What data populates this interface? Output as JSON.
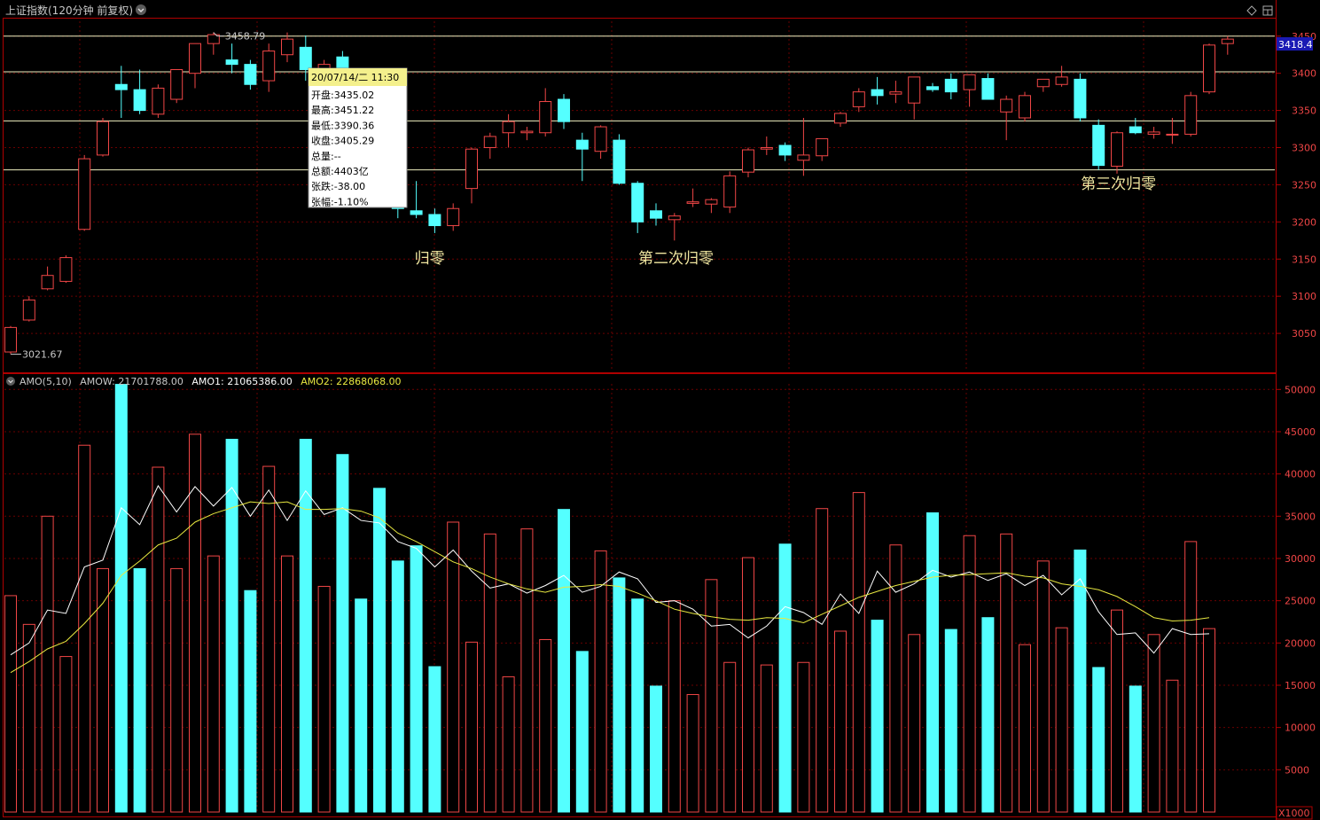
{
  "header": {
    "title": "上证指数(120分钟 前复权)",
    "icon_left": "chevron-down-icon",
    "icon_right_1": "diamond-icon",
    "icon_right_2": "layout-icon"
  },
  "price_panel": {
    "current_price_label": "3418.4",
    "high_label": "3458.79",
    "low_label": "3021.67",
    "y_ticks": [
      "3450",
      "3400",
      "3350",
      "3300",
      "3250",
      "3200",
      "3150",
      "3100",
      "3050"
    ],
    "horizontal_lines": [
      3450,
      3402,
      3336,
      3270
    ],
    "annotations": [
      {
        "text": "归零",
        "after_index": 22
      },
      {
        "text": "第二次归零",
        "after_index": 35
      },
      {
        "text": "第三次归零",
        "after_index": 59
      }
    ]
  },
  "tooltip": {
    "date": "20/07/14/二 11:30",
    "rows": [
      {
        "label": "开盘",
        "value": "3435.02"
      },
      {
        "label": "最高",
        "value": "3451.22"
      },
      {
        "label": "最低",
        "value": "3390.36"
      },
      {
        "label": "收盘",
        "value": "3405.29"
      },
      {
        "label": "总量",
        "value": "--"
      },
      {
        "label": "总额",
        "value": "4403亿"
      },
      {
        "label": "张跌",
        "value": "-38.00"
      },
      {
        "label": "张幅",
        "value": "-1.10%"
      }
    ]
  },
  "volume_panel": {
    "title": "AMO(5,10)",
    "amow_label": "AMOW: 21701788.00",
    "amo1_label": "AMO1: 21065386.00",
    "amo2_label": "AMO2: 22868068.00",
    "y_ticks": [
      "50000",
      "45000",
      "40000",
      "35000",
      "30000",
      "25000",
      "20000",
      "15000",
      "10000",
      "5000"
    ],
    "unit_label": "X1000"
  },
  "colors": {
    "up": "#f04646",
    "down": "#54ffff",
    "grid": "#6a0000",
    "axis": "#b00000",
    "level": "#f0f0c0",
    "ma5": "#ffffff",
    "ma10": "#e8e840",
    "annotation": "#f0e6a0"
  },
  "chart_data": [
    {
      "type": "candlestick",
      "title": "上证指数(120分钟 前复权)",
      "ylim": [
        3000,
        3470
      ],
      "ohlc": [
        [
          3025,
          3060,
          3022,
          3058
        ],
        [
          3068,
          3100,
          3066,
          3095
        ],
        [
          3110,
          3140,
          3108,
          3128
        ],
        [
          3120,
          3155,
          3118,
          3152
        ],
        [
          3190,
          3290,
          3188,
          3285
        ],
        [
          3290,
          3340,
          3288,
          3335
        ],
        [
          3385,
          3410,
          3340,
          3378
        ],
        [
          3378,
          3405,
          3345,
          3350
        ],
        [
          3345,
          3385,
          3340,
          3380
        ],
        [
          3365,
          3400,
          3360,
          3405
        ],
        [
          3400,
          3440,
          3380,
          3440
        ],
        [
          3440,
          3455,
          3425,
          3452
        ],
        [
          3418,
          3440,
          3400,
          3412
        ],
        [
          3412,
          3418,
          3378,
          3385
        ],
        [
          3390,
          3440,
          3375,
          3430
        ],
        [
          3425,
          3455,
          3415,
          3446
        ],
        [
          3435,
          3451,
          3390,
          3405
        ],
        [
          3405,
          3418,
          3390,
          3412
        ],
        [
          3422,
          3430,
          3375,
          3393
        ],
        [
          3385,
          3405,
          3340,
          3365
        ],
        [
          3345,
          3370,
          3310,
          3330
        ],
        [
          3300,
          3305,
          3205,
          3218
        ],
        [
          3215,
          3255,
          3205,
          3210
        ],
        [
          3210,
          3218,
          3185,
          3195
        ],
        [
          3195,
          3225,
          3188,
          3218
        ],
        [
          3245,
          3300,
          3225,
          3298
        ],
        [
          3300,
          3320,
          3285,
          3315
        ],
        [
          3320,
          3345,
          3300,
          3335
        ],
        [
          3320,
          3328,
          3310,
          3322
        ],
        [
          3320,
          3380,
          3315,
          3362
        ],
        [
          3365,
          3372,
          3325,
          3335
        ],
        [
          3310,
          3320,
          3255,
          3298
        ],
        [
          3295,
          3330,
          3285,
          3328
        ],
        [
          3310,
          3318,
          3250,
          3252
        ],
        [
          3252,
          3255,
          3185,
          3200
        ],
        [
          3215,
          3225,
          3195,
          3205
        ],
        [
          3203,
          3212,
          3175,
          3208
        ],
        [
          3225,
          3245,
          3220,
          3227
        ],
        [
          3224,
          3232,
          3212,
          3230
        ],
        [
          3220,
          3268,
          3212,
          3262
        ],
        [
          3267,
          3300,
          3260,
          3297
        ],
        [
          3298,
          3315,
          3290,
          3300
        ],
        [
          3303,
          3307,
          3282,
          3290
        ],
        [
          3283,
          3340,
          3262,
          3290
        ],
        [
          3289,
          3312,
          3282,
          3312
        ],
        [
          3333,
          3348,
          3328,
          3346
        ],
        [
          3355,
          3380,
          3348,
          3375
        ],
        [
          3378,
          3395,
          3358,
          3370
        ],
        [
          3372,
          3390,
          3360,
          3375
        ],
        [
          3360,
          3395,
          3338,
          3395
        ],
        [
          3382,
          3387,
          3375,
          3378
        ],
        [
          3392,
          3400,
          3365,
          3375
        ],
        [
          3378,
          3398,
          3355,
          3398
        ],
        [
          3393,
          3400,
          3365,
          3365
        ],
        [
          3348,
          3370,
          3310,
          3365
        ],
        [
          3340,
          3375,
          3335,
          3370
        ],
        [
          3382,
          3392,
          3375,
          3392
        ],
        [
          3385,
          3410,
          3382,
          3395
        ],
        [
          3392,
          3400,
          3335,
          3340
        ],
        [
          3330,
          3338,
          3270,
          3276
        ],
        [
          3275,
          3322,
          3265,
          3320
        ],
        [
          3328,
          3340,
          3318,
          3320
        ],
        [
          3318,
          3328,
          3312,
          3321
        ],
        [
          3318,
          3340,
          3305,
          3318
        ],
        [
          3318,
          3375,
          3315,
          3370
        ],
        [
          3375,
          3440,
          3372,
          3438
        ],
        [
          3440,
          3450,
          3425,
          3446
        ]
      ]
    },
    {
      "type": "bar",
      "title": "AMO(5,10)",
      "ylim": [
        0,
        51500
      ],
      "values": [
        25600,
        22200,
        35000,
        18400,
        43400,
        28800,
        50600,
        28800,
        40800,
        28800,
        44700,
        30300,
        44100,
        26200,
        40900,
        30300,
        44100,
        26700,
        42300,
        25200,
        38300,
        29700,
        31500,
        17200,
        34300,
        20100,
        32900,
        16000,
        33500,
        20400,
        35800,
        19000,
        30900,
        27700,
        25200,
        14900,
        25000,
        13900,
        27500,
        17700,
        30100,
        17400,
        31700,
        17700,
        35900,
        21400,
        37800,
        22700,
        31600,
        21000,
        35400,
        21600,
        32700,
        23000,
        32900,
        19800,
        29700,
        21800,
        31000,
        17100,
        23900,
        14900,
        21000,
        15600,
        32000,
        21700
      ],
      "series": [
        {
          "name": "AMO1",
          "last": 21065386.0,
          "values": [
            18600,
            20000,
            23900,
            23500,
            29000,
            29800,
            36000,
            34000,
            38600,
            35500,
            38500,
            36200,
            38400,
            35000,
            38100,
            34500,
            38000,
            35200,
            36000,
            34500,
            34200,
            32000,
            31200,
            29000,
            31000,
            28500,
            26500,
            27000,
            25900,
            26800,
            28000,
            26000,
            26700,
            28400,
            27600,
            24800,
            25000,
            24000,
            22000,
            22200,
            20600,
            22000,
            24300,
            23600,
            22200,
            25800,
            23500,
            28500,
            26000,
            27000,
            28600,
            27800,
            28400,
            27400,
            28200,
            26800,
            28000,
            25700,
            27600,
            23700,
            21000,
            21200,
            18800,
            21700,
            21000,
            21100
          ]
        },
        {
          "name": "AMO2",
          "last": 22868068.0,
          "values": [
            16500,
            17800,
            19300,
            20200,
            22300,
            24700,
            28000,
            29700,
            31600,
            32400,
            34300,
            35300,
            36000,
            36700,
            36500,
            36700,
            35800,
            35800,
            35900,
            35600,
            34800,
            33000,
            32000,
            30800,
            29600,
            28800,
            27800,
            27000,
            26400,
            26000,
            26600,
            26700,
            26900,
            26700,
            25900,
            25000,
            24000,
            23500,
            23100,
            22800,
            22700,
            23000,
            22900,
            22400,
            23400,
            24400,
            25400,
            26100,
            26800,
            27300,
            27800,
            28000,
            28100,
            28200,
            28300,
            27900,
            27700,
            27000,
            26700,
            26300,
            25500,
            24300,
            23000,
            22600,
            22700,
            23000
          ]
        }
      ]
    }
  ]
}
